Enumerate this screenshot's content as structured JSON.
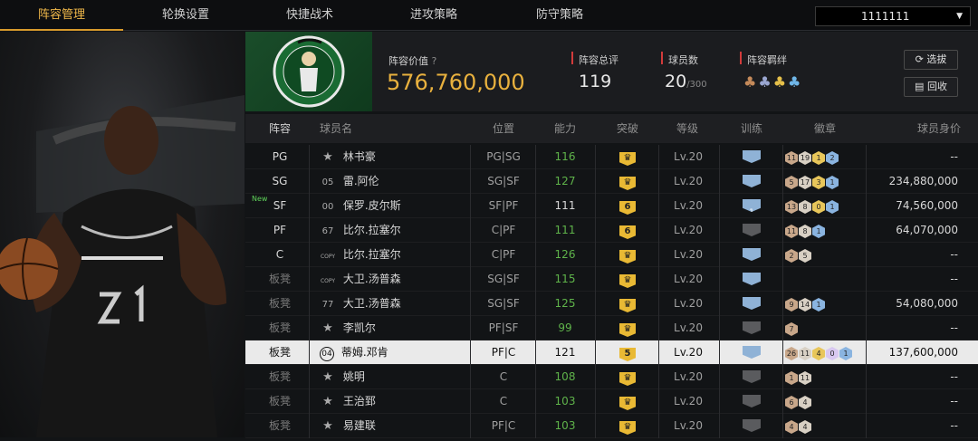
{
  "tabs": [
    "阵容管理",
    "轮换设置",
    "快捷战术",
    "进攻策略",
    "防守策略"
  ],
  "account": "1111111",
  "header": {
    "value_label": "阵容价值",
    "value": "576,760,000",
    "rating_label": "阵容总评",
    "rating": "119",
    "count_label": "球员数",
    "count": "20",
    "count_max": "/300",
    "bond_label": "阵容羁绊",
    "btn_select": "选拔",
    "btn_recycle": "回收"
  },
  "colors": {
    "accent": "#f0b84a",
    "green": "#5fb34a",
    "red": "#d23b3b",
    "team_green": "#1a4d2a"
  },
  "columns": [
    "阵容",
    "球员名",
    "位置",
    "能力",
    "突破",
    "等级",
    "训练",
    "徽章",
    "球员身价"
  ],
  "rows": [
    {
      "pos": "PG",
      "boxed": true,
      "num": "★",
      "name": "林书豪",
      "position": "PG|SG",
      "ability": "116",
      "green": true,
      "brk": "crown",
      "level": "Lv.20",
      "train": "on",
      "badges": [
        [
          "11",
          "#c8a78a"
        ],
        [
          "19",
          "#d8d0c4"
        ],
        [
          "1",
          "#e8c65a"
        ],
        [
          "2",
          "#8ab4e0"
        ]
      ],
      "price": "--"
    },
    {
      "pos": "SG",
      "boxed": true,
      "num": "05",
      "name": "雷.阿伦",
      "position": "SG|SF",
      "ability": "127",
      "green": true,
      "brk": "crown",
      "level": "Lv.20",
      "train": "on",
      "badges": [
        [
          "5",
          "#c8a78a"
        ],
        [
          "17",
          "#d8d0c4"
        ],
        [
          "3",
          "#e8c65a"
        ],
        [
          "1",
          "#8ab4e0"
        ]
      ],
      "price": "234,880,000"
    },
    {
      "pos": "SF",
      "boxed": true,
      "new": "New",
      "num": "00",
      "name": "保罗.皮尔斯",
      "position": "SF|PF",
      "ability": "111",
      "green": false,
      "brk": "6",
      "level": "Lv.20",
      "train": "on1",
      "badges": [
        [
          "13",
          "#c8a78a"
        ],
        [
          "8",
          "#d8d0c4"
        ],
        [
          "0",
          "#e8c65a"
        ],
        [
          "1",
          "#8ab4e0"
        ]
      ],
      "price": "74,560,000"
    },
    {
      "pos": "PF",
      "boxed": true,
      "num": "67",
      "name": "比尔.拉塞尔",
      "position": "C|PF",
      "ability": "111",
      "green": true,
      "brk": "6",
      "level": "Lv.20",
      "train": "off",
      "badges": [
        [
          "11",
          "#c8a78a"
        ],
        [
          "8",
          "#d8d0c4"
        ],
        [
          "1",
          "#8ab4e0"
        ]
      ],
      "price": "64,070,000"
    },
    {
      "pos": "C",
      "boxed": true,
      "num": "COPY",
      "name": "比尔.拉塞尔",
      "position": "C|PF",
      "ability": "126",
      "green": true,
      "brk": "crown",
      "level": "Lv.20",
      "train": "on",
      "badges": [
        [
          "2",
          "#c8a78a"
        ],
        [
          "5",
          "#d8d0c4"
        ]
      ],
      "price": "--"
    },
    {
      "pos": "板凳",
      "boxed": false,
      "num": "COPY",
      "name": "大卫.汤普森",
      "position": "SG|SF",
      "ability": "115",
      "green": true,
      "brk": "crown",
      "level": "Lv.20",
      "train": "on",
      "badges": [],
      "price": "--"
    },
    {
      "pos": "板凳",
      "boxed": false,
      "num": "77",
      "name": "大卫.汤普森",
      "position": "SG|SF",
      "ability": "125",
      "green": true,
      "brk": "crown",
      "level": "Lv.20",
      "train": "on",
      "badges": [
        [
          "9",
          "#c8a78a"
        ],
        [
          "14",
          "#d8d0c4"
        ],
        [
          "1",
          "#8ab4e0"
        ]
      ],
      "price": "54,080,000"
    },
    {
      "pos": "板凳",
      "boxed": false,
      "num": "★",
      "name": "李凯尔",
      "position": "PF|SF",
      "ability": "99",
      "green": true,
      "brk": "crown",
      "level": "Lv.20",
      "train": "off",
      "badges": [
        [
          "7",
          "#c8a78a"
        ]
      ],
      "price": "--"
    },
    {
      "pos": "板凳",
      "boxed": false,
      "sel": true,
      "num": "04",
      "name": "蒂姆.邓肯",
      "position": "PF|C",
      "ability": "121",
      "green": false,
      "brk": "5",
      "level": "Lv.20",
      "train": "on",
      "badges": [
        [
          "26",
          "#c8a78a"
        ],
        [
          "11",
          "#d8d0c4"
        ],
        [
          "4",
          "#e8c65a"
        ],
        [
          "0",
          "#d8c8f0"
        ],
        [
          "1",
          "#8ab4e0"
        ]
      ],
      "price": "137,600,000"
    },
    {
      "pos": "板凳",
      "boxed": false,
      "num": "★",
      "name": "姚明",
      "position": "C",
      "ability": "108",
      "green": true,
      "brk": "crown",
      "level": "Lv.20",
      "train": "off",
      "badges": [
        [
          "1",
          "#c8a78a"
        ],
        [
          "11",
          "#d8d0c4"
        ]
      ],
      "price": "--"
    },
    {
      "pos": "板凳",
      "boxed": false,
      "num": "★",
      "name": "王治郅",
      "position": "C",
      "ability": "103",
      "green": true,
      "brk": "crown",
      "level": "Lv.20",
      "train": "off",
      "badges": [
        [
          "6",
          "#c8a78a"
        ],
        [
          "4",
          "#d8d0c4"
        ]
      ],
      "price": "--"
    },
    {
      "pos": "板凳",
      "boxed": false,
      "num": "★",
      "name": "易建联",
      "position": "PF|C",
      "ability": "103",
      "green": true,
      "brk": "crown",
      "level": "Lv.20",
      "train": "off",
      "badges": [
        [
          "4",
          "#c8a78a"
        ],
        [
          "4",
          "#d8d0c4"
        ]
      ],
      "price": "--"
    }
  ]
}
